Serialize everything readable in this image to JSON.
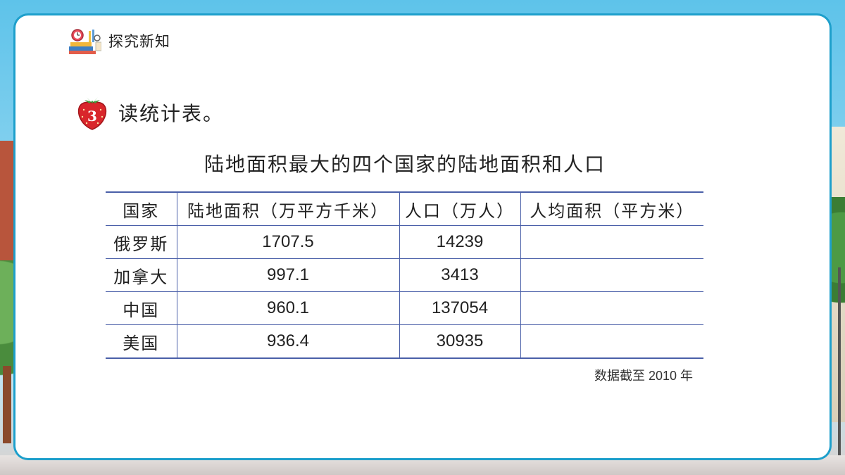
{
  "header": {
    "title": "探究新知",
    "icon": "stationery-books-icon"
  },
  "task": {
    "number": "3",
    "text": "读统计表。",
    "icon": "strawberry-icon"
  },
  "table": {
    "title": "陆地面积最大的四个国家的陆地面积和人口",
    "headers": [
      "国家",
      "陆地面积（万平方千米）",
      "人口（万人）",
      "人均面积（平方米）"
    ],
    "rows": [
      {
        "country": "俄罗斯",
        "area": "1707.5",
        "population": "14239",
        "per_capita": ""
      },
      {
        "country": "加拿大",
        "area": "997.1",
        "population": "3413",
        "per_capita": ""
      },
      {
        "country": "中国",
        "area": "960.1",
        "population": "137054",
        "per_capita": ""
      },
      {
        "country": "美国",
        "area": "936.4",
        "population": "30935",
        "per_capita": ""
      }
    ],
    "footnote": "数据截至 2010 年"
  },
  "colors": {
    "frame": "#1d9fcb",
    "table_line": "#4a5fa8",
    "strawberry": "#d9262b"
  }
}
